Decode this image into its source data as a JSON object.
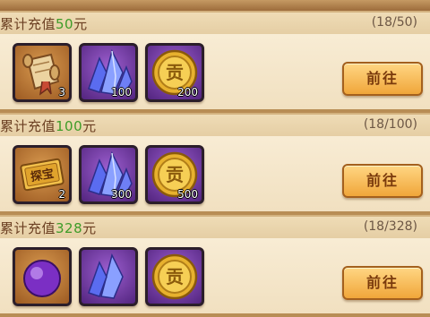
{
  "top_strip": "",
  "tiers": [
    {
      "title_prefix": "累计充值",
      "title_amount": "50",
      "title_suffix": "元",
      "progress": "(18/50)",
      "button_label": "前往",
      "rewards": [
        {
          "item": "scroll-icon",
          "quantity": "3",
          "frame": "orange"
        },
        {
          "item": "purple-crystal-icon",
          "quantity": "100",
          "frame": "purple"
        },
        {
          "item": "gold-coin-icon",
          "quantity": "200",
          "frame": "purple",
          "coin_char": "贡"
        }
      ]
    },
    {
      "title_prefix": "累计充值",
      "title_amount": "100",
      "title_suffix": "元",
      "progress": "(18/100)",
      "button_label": "前往",
      "rewards": [
        {
          "item": "treasure-ticket-icon",
          "quantity": "2",
          "frame": "orange",
          "ticket_text": "探宝"
        },
        {
          "item": "purple-crystal-icon",
          "quantity": "300",
          "frame": "purple"
        },
        {
          "item": "gold-coin-icon",
          "quantity": "500",
          "frame": "purple",
          "coin_char": "贡"
        }
      ]
    },
    {
      "title_prefix": "累计充值",
      "title_amount": "328",
      "title_suffix": "元",
      "progress": "(18/328)",
      "button_label": "前往",
      "rewards": [
        {
          "item": "purple-orb-icon",
          "quantity": "",
          "frame": "orange"
        },
        {
          "item": "purple-crystal-icon",
          "quantity": "",
          "frame": "purple"
        },
        {
          "item": "gold-coin-icon",
          "quantity": "",
          "frame": "purple",
          "coin_char": "贡"
        }
      ]
    }
  ],
  "colors": {
    "amount_green": "#3e9c28",
    "title_brown": "#6b3f22",
    "button_orange": "#f0a63a"
  }
}
